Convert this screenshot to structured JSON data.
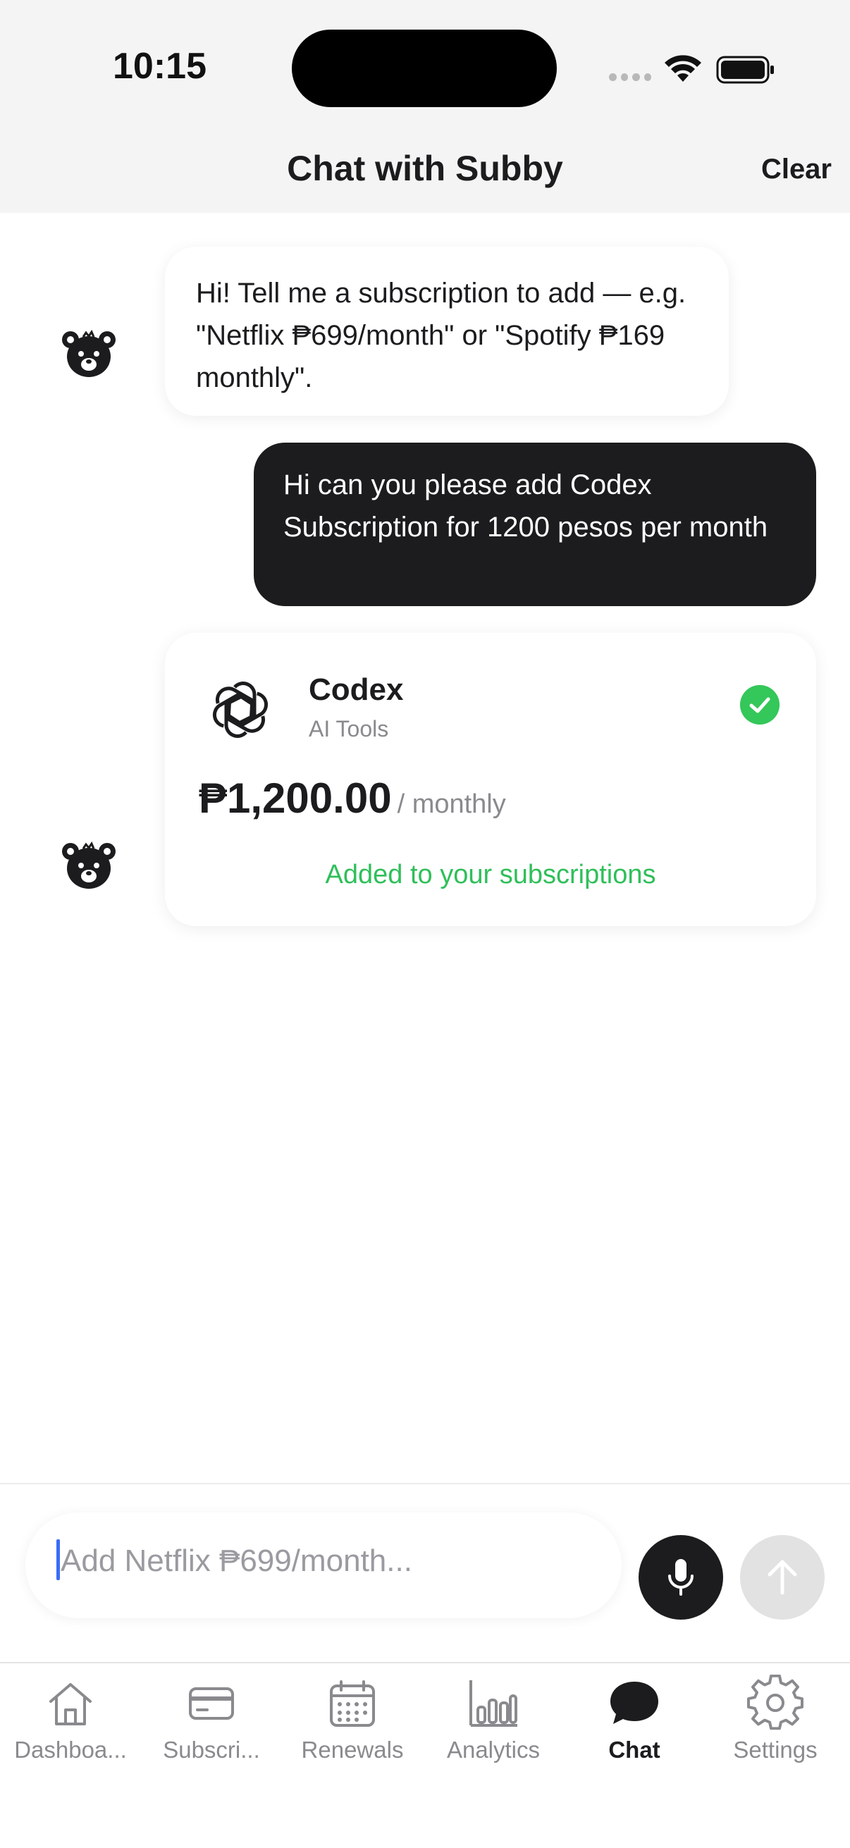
{
  "status_bar": {
    "time": "10:15"
  },
  "nav": {
    "title": "Chat with Subby",
    "clear_label": "Clear"
  },
  "messages": {
    "bot_intro": "Hi! Tell me a subscription to add — e.g. \"Netflix ₱699/month\" or \"Spotify ₱169 monthly\".",
    "user": "Hi can you please add Codex Subscription for 1200 pesos per month"
  },
  "card": {
    "name": "Codex",
    "category": "AI Tools",
    "amount": "₱1,200.00",
    "period": "/ monthly",
    "status": "Added to your subscriptions",
    "status_color": "#2fbf5a"
  },
  "composer": {
    "placeholder": "Add Netflix ₱699/month..."
  },
  "tabs": [
    {
      "label": "Dashboa...",
      "icon": "home-icon"
    },
    {
      "label": "Subscri...",
      "icon": "credit-card-icon"
    },
    {
      "label": "Renewals",
      "icon": "calendar-icon"
    },
    {
      "label": "Analytics",
      "icon": "bar-chart-icon"
    },
    {
      "label": "Chat",
      "icon": "chat-bubble-icon",
      "active": true
    },
    {
      "label": "Settings",
      "icon": "gear-icon"
    }
  ],
  "colors": {
    "accent_dark": "#1c1c1e",
    "success": "#34c759",
    "header_bg": "#f4f4f4"
  }
}
